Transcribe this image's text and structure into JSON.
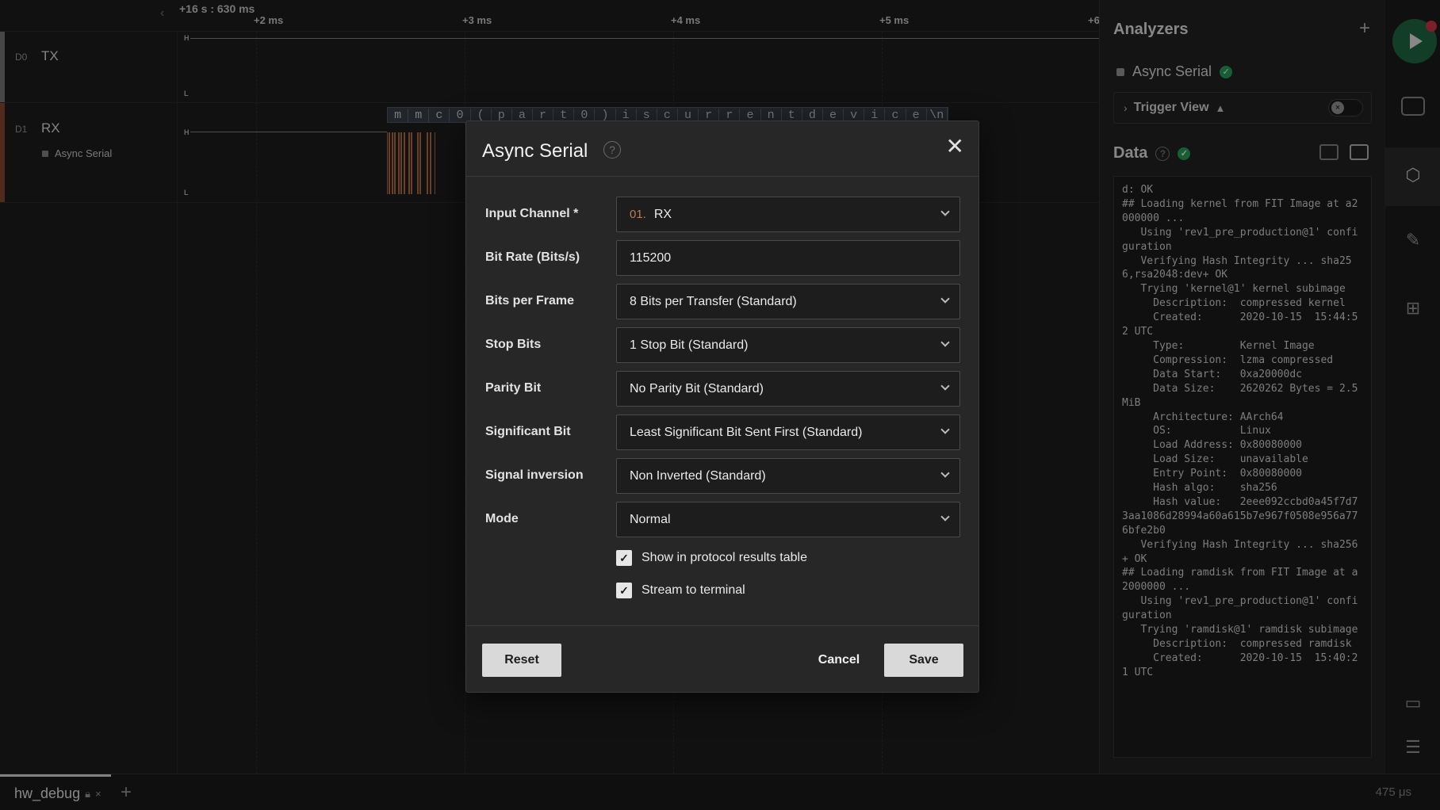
{
  "ruler": {
    "offset": "+16 s : 630 ms",
    "ticks": [
      "+2 ms",
      "+3 ms",
      "+4 ms",
      "+5 ms",
      "+6"
    ]
  },
  "channels": [
    {
      "id": "D0",
      "name": "TX",
      "color": "#7a7a7a"
    },
    {
      "id": "D1",
      "name": "RX",
      "color": "#8a4a33",
      "analyzer": "Async Serial"
    }
  ],
  "levels": {
    "high": "H",
    "low": "L"
  },
  "decode_chars": [
    "m",
    "m",
    "c",
    "0",
    "(",
    "p",
    "a",
    "r",
    "t",
    "0",
    ")",
    "i",
    "s",
    "c",
    "u",
    "r",
    "r",
    "e",
    "n",
    "t",
    "d",
    "e",
    "v",
    "i",
    "c",
    "e",
    "\\n"
  ],
  "bottom_bar": {
    "tab": "hw_debug",
    "add": "+",
    "close": "×",
    "time": "475 μs"
  },
  "side": {
    "title": "Analyzers",
    "add": "+",
    "analyzer_name": "Async Serial",
    "trigger_label": "Trigger View",
    "data_title": "Data",
    "terminal": "d: OK\n## Loading kernel from FIT Image at a2000000 ...\n   Using 'rev1_pre_production@1' configuration\n   Verifying Hash Integrity ... sha256,rsa2048:dev+ OK\n   Trying 'kernel@1' kernel subimage\n     Description:  compressed kernel\n     Created:      2020-10-15  15:44:52 UTC\n     Type:         Kernel Image\n     Compression:  lzma compressed\n     Data Start:   0xa20000dc\n     Data Size:    2620262 Bytes = 2.5 MiB\n     Architecture: AArch64\n     OS:           Linux\n     Load Address: 0x80080000\n     Load Size:    unavailable\n     Entry Point:  0x80080000\n     Hash algo:    sha256\n     Hash value:   2eee092ccbd0a45f7d73aa1086d28994a60a615b7e967f0508e956a776bfe2b0\n   Verifying Hash Integrity ... sha256+ OK\n## Loading ramdisk from FIT Image at a2000000 ...\n   Using 'rev1_pre_production@1' configuration\n   Trying 'ramdisk@1' ramdisk subimage\n     Description:  compressed ramdisk\n     Created:      2020-10-15  15:40:21 UTC"
  },
  "modal": {
    "title": "Async Serial",
    "close": "✕",
    "help": "?",
    "fields": [
      {
        "label": "Input Channel *",
        "prefix": "01.",
        "value": "RX",
        "type": "select"
      },
      {
        "label": "Bit Rate (Bits/s)",
        "value": "115200",
        "type": "input"
      },
      {
        "label": "Bits per Frame",
        "value": "8 Bits per Transfer (Standard)",
        "type": "select"
      },
      {
        "label": "Stop Bits",
        "value": "1 Stop Bit (Standard)",
        "type": "select"
      },
      {
        "label": "Parity Bit",
        "value": "No Parity Bit (Standard)",
        "type": "select"
      },
      {
        "label": "Significant Bit",
        "value": "Least Significant Bit Sent First (Standard)",
        "type": "select"
      },
      {
        "label": "Signal inversion",
        "value": "Non Inverted (Standard)",
        "type": "select"
      },
      {
        "label": "Mode",
        "value": "Normal",
        "type": "select"
      }
    ],
    "checkboxes": [
      {
        "label": "Show in protocol results table",
        "checked": true
      },
      {
        "label": "Stream to terminal",
        "checked": true
      }
    ],
    "buttons": {
      "reset": "Reset",
      "cancel": "Cancel",
      "save": "Save"
    }
  }
}
